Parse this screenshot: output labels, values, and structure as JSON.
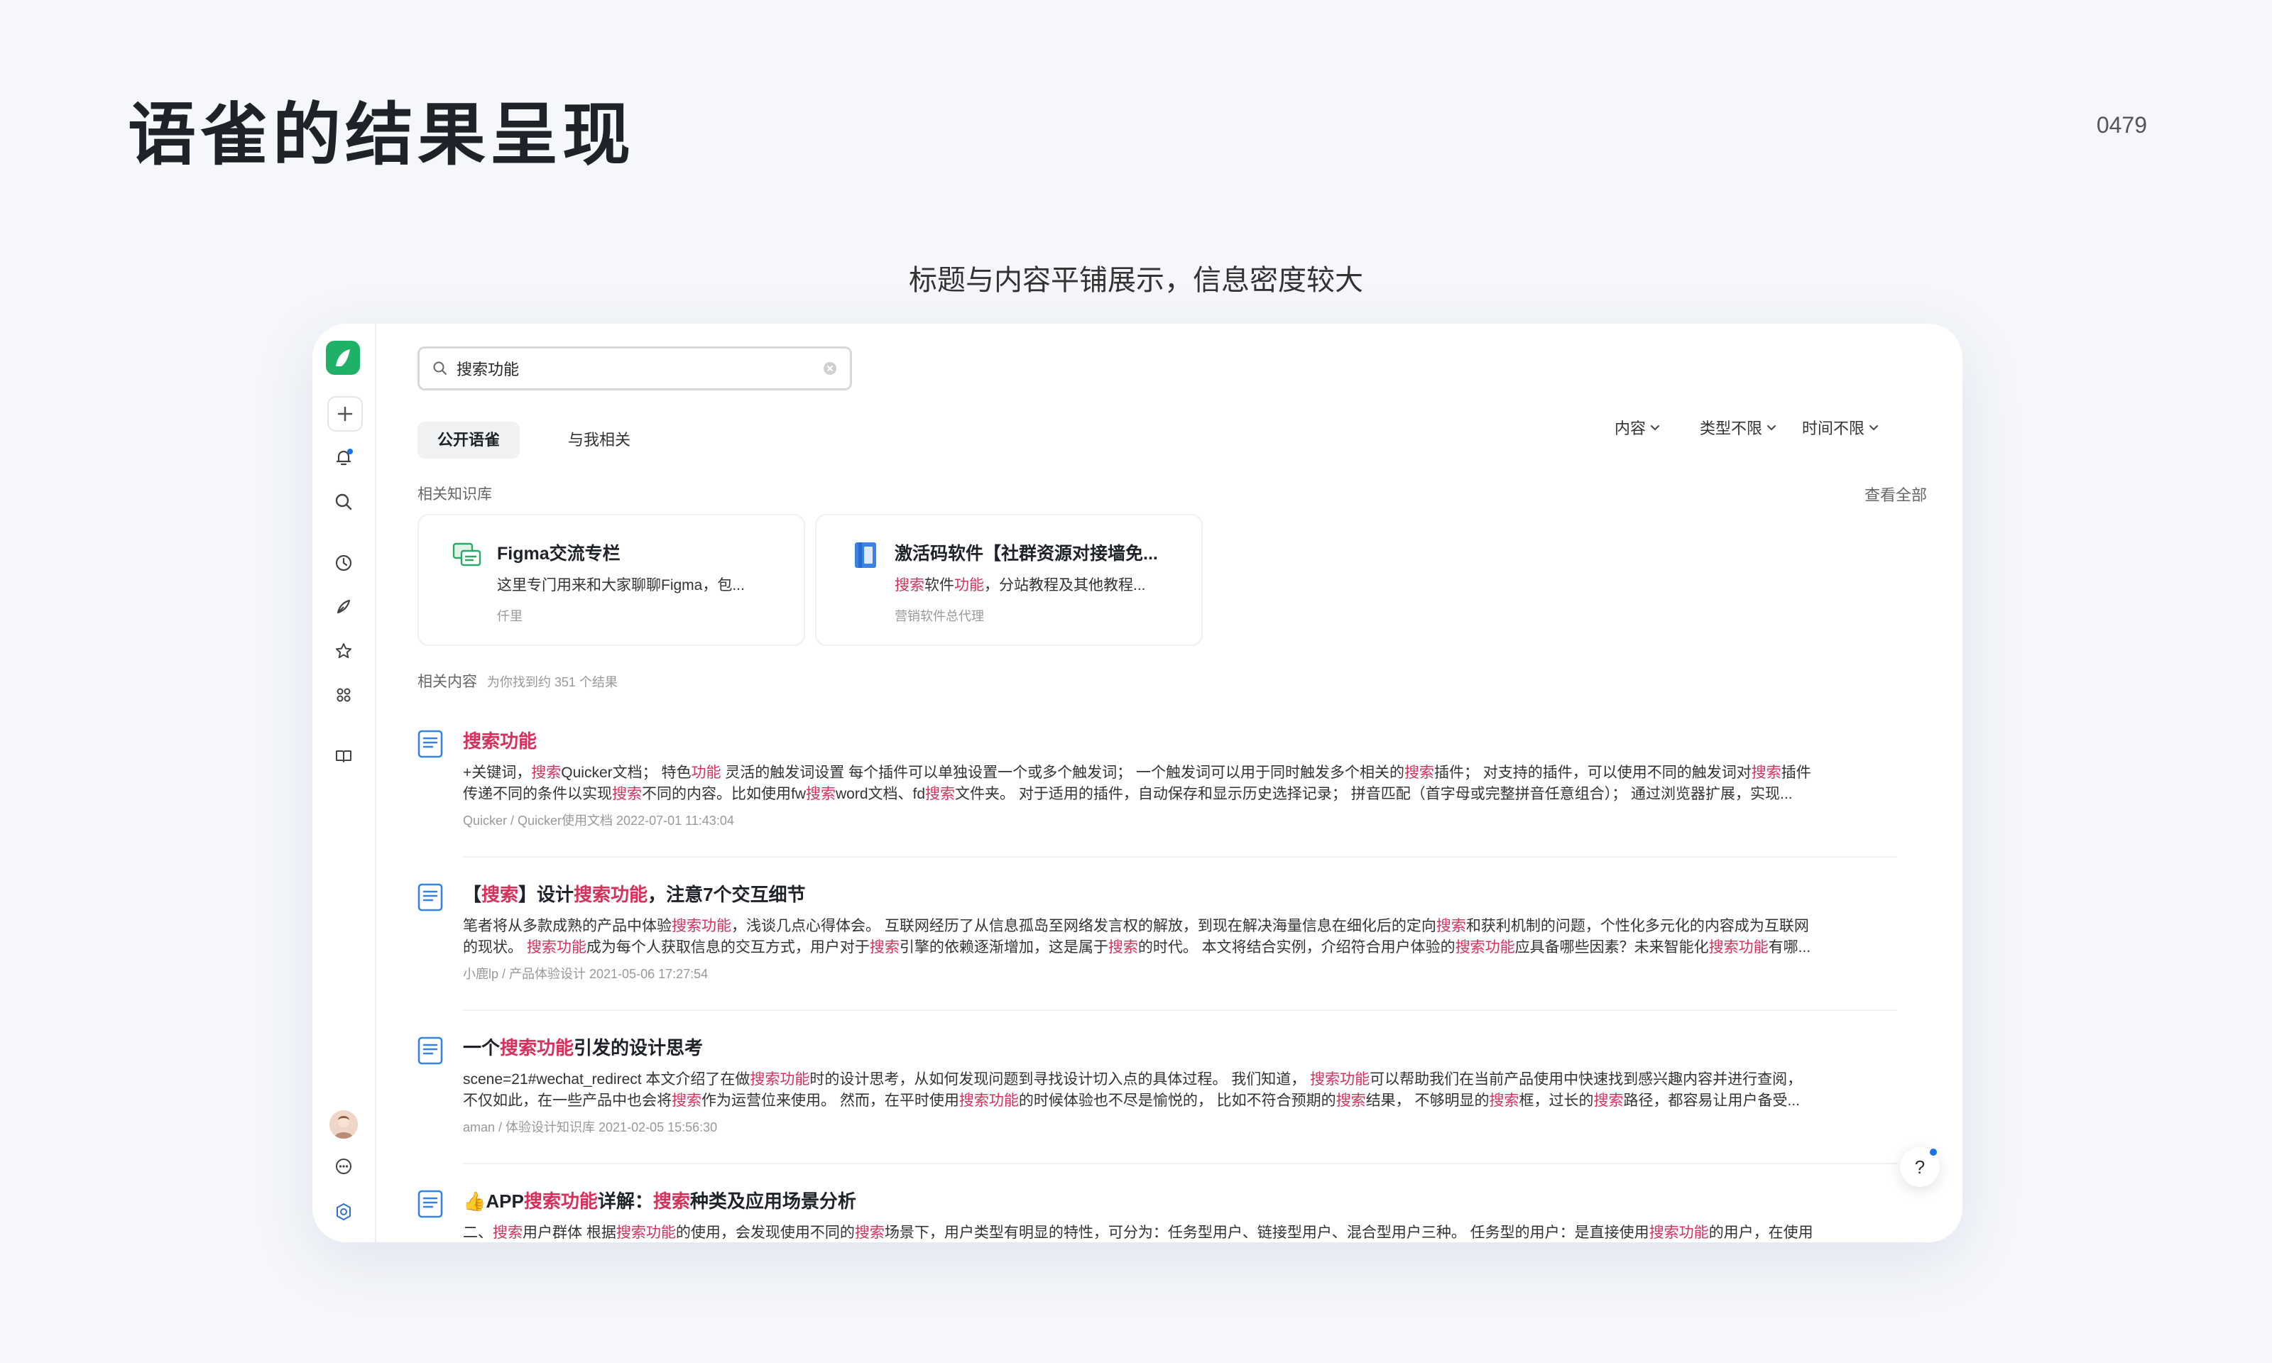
{
  "slide": {
    "title": "语雀的结果呈现",
    "page_number": "0479",
    "subtitle": "标题与内容平铺展示，信息密度较大"
  },
  "search": {
    "value": "搜索功能"
  },
  "tabs": [
    {
      "label": "公开语雀",
      "active": true
    },
    {
      "label": "与我相关",
      "active": false
    }
  ],
  "filters": [
    "内容",
    "类型不限",
    "时间不限"
  ],
  "knowledge_section": {
    "label": "相关知识库",
    "view_all": "查看全部"
  },
  "knowledge_bases": [
    {
      "title": "Figma交流专栏",
      "desc": "这里专门用来和大家聊聊Figma，包...",
      "owner": "仟里"
    },
    {
      "title": "激活码软件【社群资源对接墙免...",
      "desc_parts": [
        {
          "t": "搜索",
          "h": true
        },
        {
          "t": "软件",
          "h": false
        },
        {
          "t": "功能",
          "h": true
        },
        {
          "t": "，分站教程及其他教程...",
          "h": false
        }
      ],
      "owner": "营销软件总代理"
    }
  ],
  "results_section": {
    "label": "相关内容",
    "count_text": "为你找到约 351 个结果"
  },
  "results": [
    {
      "title_parts": [
        {
          "t": "搜索功能",
          "h": true
        }
      ],
      "lines": [
        [
          {
            "t": "+关键词，",
            "h": false
          },
          {
            "t": "搜索",
            "h": true
          },
          {
            "t": "Quicker文档； 特色",
            "h": false
          },
          {
            "t": "功能",
            "h": true
          },
          {
            "t": " 灵活的触发词设置 每个插件可以单独设置一个或多个触发词； 一个触发词可以用于同时触发多个相关的",
            "h": false
          },
          {
            "t": "搜索",
            "h": true
          },
          {
            "t": "插件； 对支持的插件，可以使用不同的触发词对",
            "h": false
          },
          {
            "t": "搜索",
            "h": true
          },
          {
            "t": "插件",
            "h": false
          }
        ],
        [
          {
            "t": "传递不同的条件以实现",
            "h": false
          },
          {
            "t": "搜索",
            "h": true
          },
          {
            "t": "不同的内容。比如使用fw",
            "h": false
          },
          {
            "t": "搜索",
            "h": true
          },
          {
            "t": "word文档、fd",
            "h": false
          },
          {
            "t": "搜索",
            "h": true
          },
          {
            "t": "文件夹。 对于适用的插件，自动保存和显示历史选择记录； 拼音匹配（首字母或完整拼音任意组合）； 通过浏览器扩展，实现...",
            "h": false
          }
        ]
      ],
      "meta": "Quicker / Quicker使用文档    2022-07-01 11:43:04"
    },
    {
      "title_parts": [
        {
          "t": "【",
          "h": false
        },
        {
          "t": "搜索",
          "h": true
        },
        {
          "t": "】设计",
          "h": false
        },
        {
          "t": "搜索功能",
          "h": true
        },
        {
          "t": "，注意7个交互细节",
          "h": false
        }
      ],
      "lines": [
        [
          {
            "t": "笔者将从多款成熟的产品中体验",
            "h": false
          },
          {
            "t": "搜索功能",
            "h": true
          },
          {
            "t": "，浅谈几点心得体会。 互联网经历了从信息孤岛至网络发言权的解放，到现在解决海量信息在细化后的定向",
            "h": false
          },
          {
            "t": "搜索",
            "h": true
          },
          {
            "t": "和获利机制的问题，个性化多元化的内容成为互联网",
            "h": false
          }
        ],
        [
          {
            "t": "的现状。 ",
            "h": false
          },
          {
            "t": "搜索功能",
            "h": true
          },
          {
            "t": "成为每个人获取信息的交互方式，用户对于",
            "h": false
          },
          {
            "t": "搜索",
            "h": true
          },
          {
            "t": "引擎的依赖逐渐增加，这是属于",
            "h": false
          },
          {
            "t": "搜索",
            "h": true
          },
          {
            "t": "的时代。 本文将结合实例，介绍符合用户体验的",
            "h": false
          },
          {
            "t": "搜索功能",
            "h": true
          },
          {
            "t": "应具备哪些因素？未来智能化",
            "h": false
          },
          {
            "t": "搜索功能",
            "h": true
          },
          {
            "t": "有哪...",
            "h": false
          }
        ]
      ],
      "meta": "小鹿lp / 产品体验设计    2021-05-06 17:27:54"
    },
    {
      "title_parts": [
        {
          "t": "一个",
          "h": false
        },
        {
          "t": "搜索功能",
          "h": true
        },
        {
          "t": "引发的设计思考",
          "h": false
        }
      ],
      "lines": [
        [
          {
            "t": "scene=21#wechat_redirect 本文介绍了在做",
            "h": false
          },
          {
            "t": "搜索功能",
            "h": true
          },
          {
            "t": "时的设计思考，从如何发现问题到寻找设计切入点的具体过程。 我们知道， ",
            "h": false
          },
          {
            "t": "搜索功能",
            "h": true
          },
          {
            "t": "可以帮助我们在当前产品使用中快速找到感兴趣内容并进行查阅，",
            "h": false
          }
        ],
        [
          {
            "t": "不仅如此，在一些产品中也会将",
            "h": false
          },
          {
            "t": "搜索",
            "h": true
          },
          {
            "t": "作为运营位来使用。 然而，在平时使用",
            "h": false
          },
          {
            "t": "搜索功能",
            "h": true
          },
          {
            "t": "的时候体验也不尽是愉悦的， 比如不符合预期的",
            "h": false
          },
          {
            "t": "搜索",
            "h": true
          },
          {
            "t": "结果， 不够明显的",
            "h": false
          },
          {
            "t": "搜索",
            "h": true
          },
          {
            "t": "框，过长的",
            "h": false
          },
          {
            "t": "搜索",
            "h": true
          },
          {
            "t": "路径，都容易让用户备受...",
            "h": false
          }
        ]
      ],
      "meta": "aman / 体验设计知识库    2021-02-05 15:56:30"
    },
    {
      "title_parts": [
        {
          "t": "👍APP",
          "h": false
        },
        {
          "t": "搜索功能",
          "h": true
        },
        {
          "t": "详解：",
          "h": false
        },
        {
          "t": "搜索",
          "h": true
        },
        {
          "t": "种类及应用场景分析",
          "h": false
        }
      ],
      "lines": [
        [
          {
            "t": "二、",
            "h": false
          },
          {
            "t": "搜索",
            "h": true
          },
          {
            "t": "用户群体 根据",
            "h": false
          },
          {
            "t": "搜索功能",
            "h": true
          },
          {
            "t": "的使用，会发现使用不同的",
            "h": false
          },
          {
            "t": "搜索",
            "h": true
          },
          {
            "t": "场景下，用户类型有明显的特性，可分为：任务型用户、链接型用户、混合型用户三种。 任务型的用户：是直接使用",
            "h": false
          },
          {
            "t": "搜索功能",
            "h": true
          },
          {
            "t": "的用户，在使用",
            "h": false
          }
        ]
      ],
      "meta": ""
    }
  ],
  "help": {
    "label": "?"
  },
  "icons": {
    "sidebar": [
      "plus-icon",
      "bell-icon",
      "search-icon",
      "clock-icon",
      "pen-icon",
      "star-icon",
      "apps-icon",
      "book-icon",
      "more-icon",
      "settings-icon"
    ]
  },
  "colors": {
    "brand": "#1fb168",
    "highlight": "#d7305a",
    "notify": "#1a73e8"
  }
}
